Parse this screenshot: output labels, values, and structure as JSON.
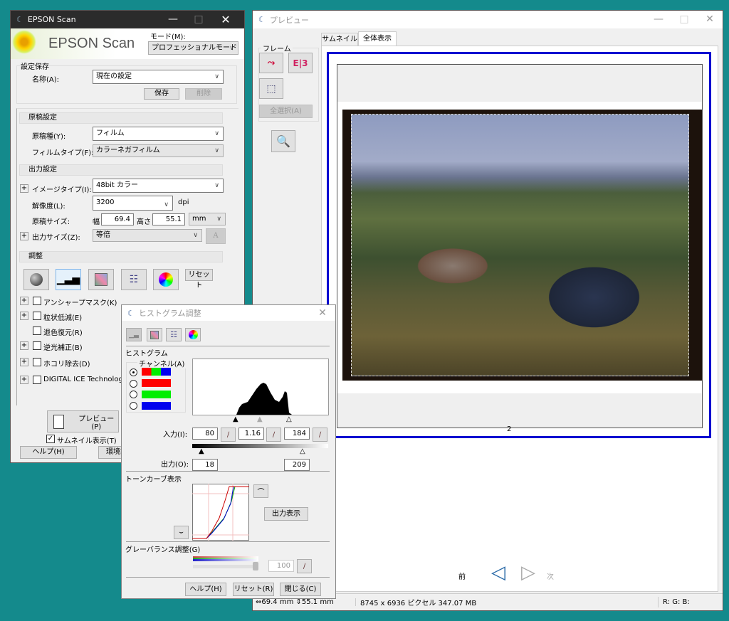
{
  "main_window": {
    "title": "EPSON Scan",
    "logo_text": "EPSON Scan",
    "mode_label": "モード(M):",
    "mode_value": "プロフェッショナルモード",
    "settings_save": {
      "group_label": "設定保存",
      "name_label": "名称(A):",
      "name_value": "現在の設定",
      "save_button": "保存",
      "delete_button": "削除"
    },
    "original_settings": {
      "header": "原稿設定",
      "doc_type_label": "原稿種(Y):",
      "doc_type_value": "フィルム",
      "film_type_label": "フィルムタイプ(F):",
      "film_type_value": "カラーネガフィルム"
    },
    "output_settings": {
      "header": "出力設定",
      "image_type_label": "イメージタイプ(I):",
      "image_type_value": "48bit カラー",
      "resolution_label": "解像度(L):",
      "resolution_value": "3200",
      "resolution_unit": "dpi",
      "size_label": "原稿サイズ:",
      "width_label": "幅",
      "width_value": "69.4",
      "height_label": "高さ",
      "height_value": "55.1",
      "unit_value": "mm",
      "output_size_label": "出力サイズ(Z):",
      "output_size_value": "等倍",
      "font_button": "A"
    },
    "adjust": {
      "header": "調整",
      "reset_button": "リセット",
      "options": [
        {
          "label": "アンシャープマスク(K)",
          "expand": true,
          "checked": false
        },
        {
          "label": "粒状低減(E)",
          "expand": true,
          "checked": false
        },
        {
          "label": "退色復元(R)",
          "expand": false,
          "checked": false
        },
        {
          "label": "逆光補正(B)",
          "expand": true,
          "checked": false
        },
        {
          "label": "ホコリ除去(D)",
          "expand": true,
          "checked": false
        },
        {
          "label": "DIGITAL ICE Technology",
          "expand": true,
          "checked": false
        }
      ]
    },
    "preview_button": "プレビュー(P)",
    "thumbnail_check": "サムネイル表示(T)",
    "help_button": "ヘルプ(H)",
    "config_button": "環境設"
  },
  "preview_window": {
    "title": "プレビュー",
    "tabs": [
      "サムネイル",
      "全体表示"
    ],
    "active_tab": "全体表示",
    "frame_group": "フレーム",
    "select_all_button": "全選択(A)",
    "frame_number": "2",
    "prev_label": "前",
    "next_label": "次",
    "status": {
      "dimensions": "69.4 mm",
      "height": "55.1 mm",
      "pixels": "8745 x 6936 ピクセル 347.07 MB",
      "rgb": "R: G: B:"
    }
  },
  "histogram_dialog": {
    "title": "ヒストグラム調整",
    "histogram_label": "ヒストグラム",
    "channel_label": "チャンネル(A)",
    "selected_channel": 0,
    "input_label": "入力(I):",
    "input_shadow": "80",
    "input_gamma": "1.16",
    "input_highlight": "184",
    "output_label": "出力(O):",
    "output_shadow": "18",
    "output_highlight": "209",
    "tone_curve_label": "トーンカーブ表示",
    "output_display_button": "出力表示",
    "gray_balance_label": "グレーバランス調整(G)",
    "gray_balance_value": "100",
    "gray_balance_level": 1.0,
    "help_button": "ヘルプ(H)",
    "reset_button": "リセット(R)",
    "close_button": "閉じる(C)"
  }
}
